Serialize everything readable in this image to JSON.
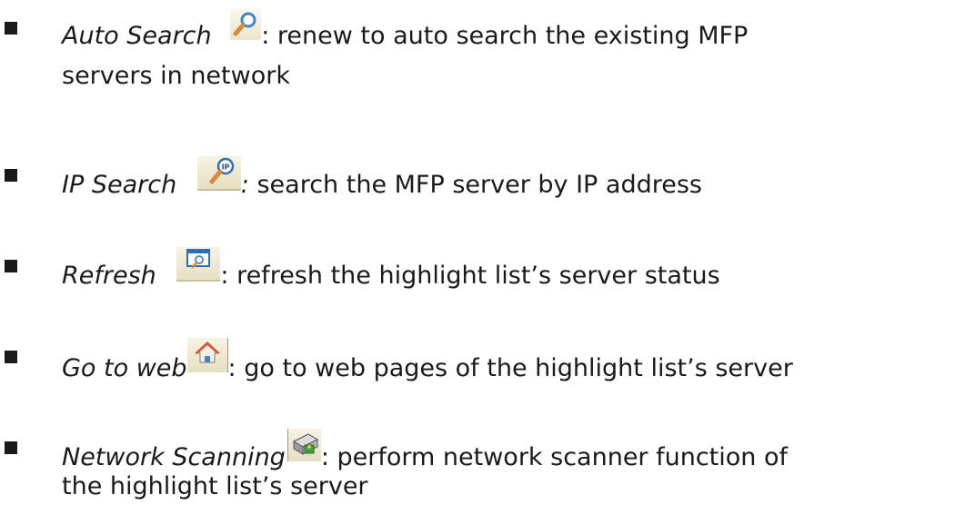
{
  "items": [
    {
      "term": "Auto Search",
      "icon": "magnifier-icon",
      "separator": ":",
      "description": " renew to auto search the existing MFP",
      "continuation": "servers in network"
    },
    {
      "term": "IP Search",
      "icon": "ip-magnifier-icon",
      "separator": ":",
      "description": " search the MFP server by IP address"
    },
    {
      "term": "Refresh",
      "icon": "refresh-window-icon",
      "separator": ":",
      "description": " refresh the highlight list’s server status"
    },
    {
      "term": "Go to web",
      "icon": "home-icon",
      "separator": ":",
      "description": " go to web pages of the highlight list’s server"
    },
    {
      "term": "Network Scanning",
      "icon": "scanner-icon",
      "separator": ":",
      "description": " perform network scanner function of",
      "continuation": "the highlight list’s server"
    }
  ],
  "colors": {
    "text": "#1a1a1a",
    "icon_background": "#efe9d3"
  }
}
